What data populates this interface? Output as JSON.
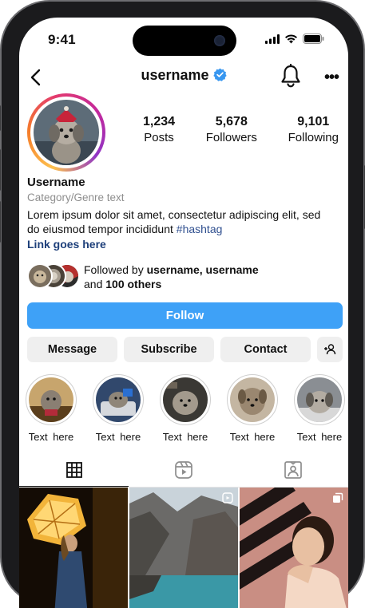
{
  "status_bar": {
    "time": "9:41"
  },
  "header": {
    "username": "username",
    "back_icon": "chevron-left-icon",
    "verified_icon": "verified-badge-icon",
    "bell_icon": "bell-icon",
    "more_label": "•••"
  },
  "profile": {
    "stats": [
      {
        "value": "1,234",
        "label": "Posts"
      },
      {
        "value": "5,678",
        "label": "Followers"
      },
      {
        "value": "9,101",
        "label": "Following"
      }
    ],
    "name": "Username",
    "category": "Category/Genre text",
    "bio_text": "Lorem ipsum dolor sit amet, consectetur adipiscing elit, sed do eiusmod tempor incididunt ",
    "bio_hashtag": "#hashtag",
    "link": "Link goes here",
    "followed_prefix": "Followed by ",
    "followed_names": "username, username",
    "followed_and": "and ",
    "followed_others": "100 others"
  },
  "actions": {
    "follow": "Follow",
    "message": "Message",
    "subscribe": "Subscribe",
    "contact": "Contact",
    "suggest_icon": "add-person-icon"
  },
  "highlights": [
    {
      "label": "Text here"
    },
    {
      "label": "Text here"
    },
    {
      "label": "Text here"
    },
    {
      "label": "Text here"
    },
    {
      "label": "Text here"
    }
  ],
  "tabs": [
    {
      "icon": "grid-icon",
      "active": true
    },
    {
      "icon": "reels-icon",
      "active": false
    },
    {
      "icon": "tagged-icon",
      "active": false
    }
  ],
  "colors": {
    "follow_button": "#3ea1f7",
    "verified": "#3897f0",
    "link": "#1d3f7a",
    "secondary_button": "#efefef"
  }
}
